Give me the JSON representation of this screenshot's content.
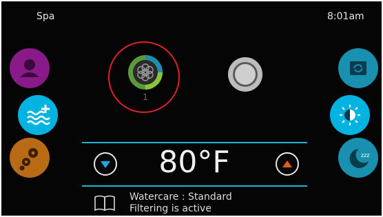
{
  "header": {
    "title": "Spa",
    "time": "8:01am"
  },
  "pump": {
    "number": "1"
  },
  "temperature": {
    "value": "80°F"
  },
  "status": {
    "line1": "Watercare : Standard",
    "line2": "Filtering is active"
  },
  "icons": {
    "left": [
      "user-icon",
      "water-heat-icon",
      "gears-icon"
    ],
    "right": [
      "flip-screen-icon",
      "brightness-icon",
      "sleep-icon"
    ],
    "center": [
      "pump-icon",
      "light-icon"
    ],
    "temp": [
      "arrow-down-icon",
      "arrow-up-icon"
    ],
    "bottom": "book-icon"
  },
  "colors": {
    "purple": "#8a1a8a",
    "cyan": "#00b3e0",
    "orange": "#b86a14",
    "teal": "#1a90b0",
    "accent_line": "#19b6d8",
    "highlight_ring": "#e0202a",
    "up_arrow": "#e85a1a"
  }
}
